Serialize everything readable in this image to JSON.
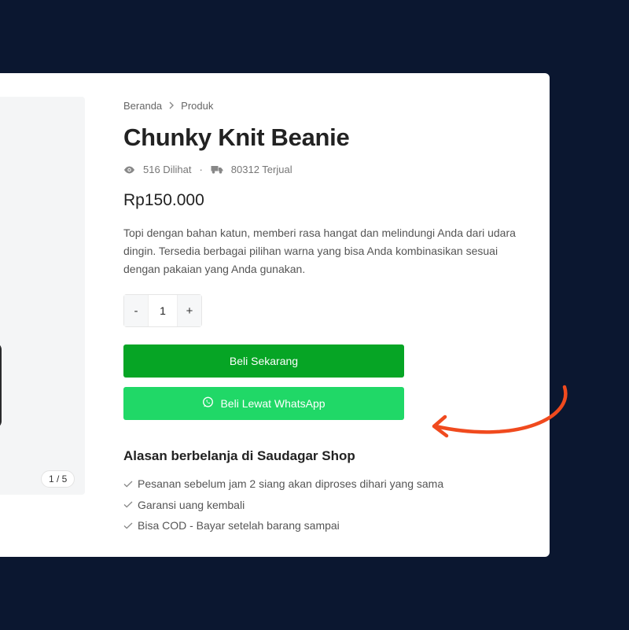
{
  "gallery": {
    "counter": "1 / 5"
  },
  "breadcrumb": {
    "home": "Beranda",
    "current": "Produk"
  },
  "product": {
    "title": "Chunky Knit Beanie",
    "views": "516 Dilihat",
    "separator": "·",
    "sold": "80312 Terjual",
    "price": "Rp150.000",
    "description": "Topi dengan bahan katun, memberi rasa hangat dan melindungi Anda dari udara dingin. Tersedia berbagai pilihan warna yang bisa Anda kombinasikan sesuai dengan pakaian yang Anda gunakan."
  },
  "quantity": {
    "minus": "-",
    "value": "1",
    "plus": "+"
  },
  "actions": {
    "buy_label": "Beli Sekarang",
    "whatsapp_label": "Beli Lewat WhatsApp"
  },
  "reasons": {
    "title": "Alasan berbelanja di Saudagar Shop",
    "items": [
      "Pesanan sebelum jam 2 siang akan diproses dihari yang sama",
      "Garansi uang kembali",
      "Bisa COD - Bayar setelah barang sampai"
    ]
  },
  "colors": {
    "background": "#0b1730",
    "buy_button": "#06a525",
    "whatsapp_button": "#20d867",
    "arrow": "#f04a1e"
  },
  "icons": {
    "views": "eye-icon",
    "sold": "truck-icon",
    "whatsapp": "whatsapp-icon",
    "check": "check-icon",
    "arrow": "curved-arrow-icon"
  }
}
